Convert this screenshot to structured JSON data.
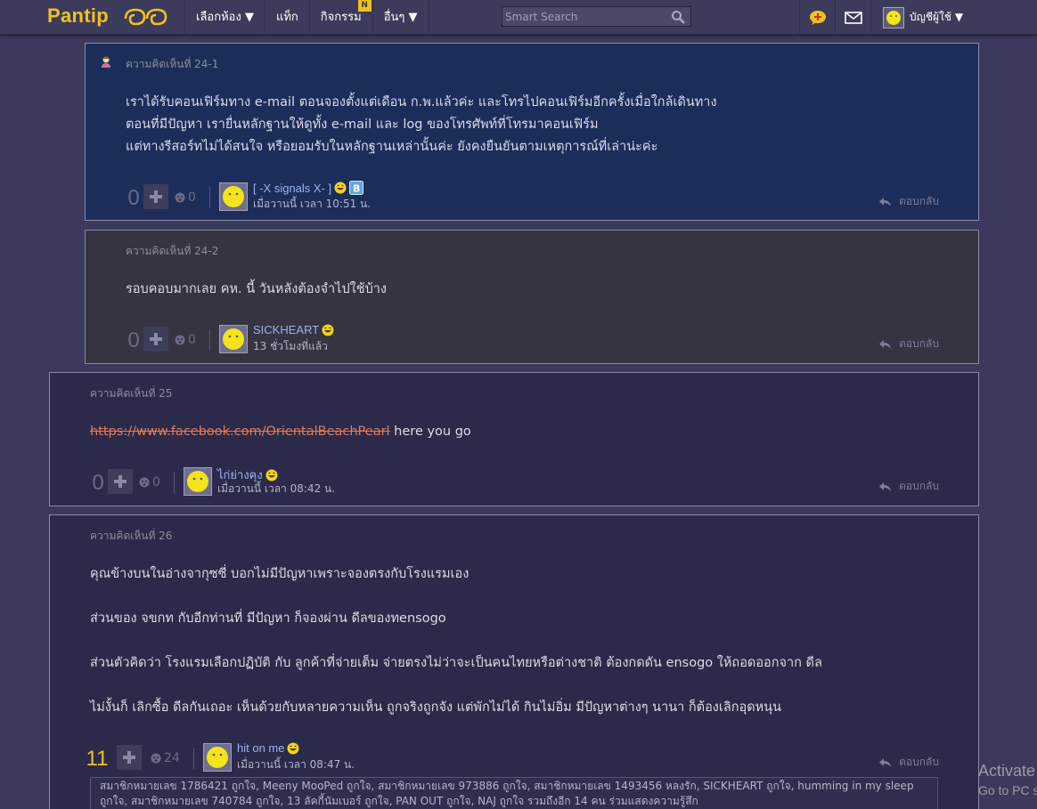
{
  "topbar": {
    "logo": "Pantip",
    "nav": [
      {
        "label": "เลือกห้อง ▼"
      },
      {
        "label": "แท็ก"
      },
      {
        "label": "กิจกรรม",
        "badge": "N"
      },
      {
        "label": "อื่นๆ ▼"
      }
    ],
    "search_placeholder": "Smart Search",
    "account_label": "บัญชีผู้ใช้ ▼"
  },
  "comments": [
    {
      "label": "ความคิดเห็นที่ 24-1",
      "body": "เราได้รับคอนเฟิร์มทาง e-mail ตอนจองตั้งแต่เดือน ก.พ.แล้วค่ะ และโทรไปคอนเฟิร์มอีกครั้งเมื่อใกล้เดินทาง\nตอนที่มีปัญหา เรายื่นหลักฐานให้ดูทั้ง e-mail และ log ของโทรศัพท์ที่โทรมาคอนเฟิร์ม\nแต่ทางรีสอร์ทไม่ได้สนใจ หรือยอมรับในหลักฐานเหล่านั้นค่ะ ยังคงยืนยันตามเหตุการณ์ที่เล่าน่ะค่ะ",
      "votes": "0",
      "emotions": "0",
      "user": "[ -X signals X- ]",
      "time": "เมื่อวานนี้ เวลา 10:51 น.",
      "reply": "ตอบกลับ"
    },
    {
      "label": "ความคิดเห็นที่ 24-2",
      "body": "รอบคอบมากเลย คห. นี้ วันหลังต้องจำไปใช้บ้าง",
      "votes": "0",
      "emotions": "0",
      "user": "SICKHEART",
      "time": "13 ชั่วโมงที่แล้ว",
      "reply": "ตอบกลับ"
    },
    {
      "label": "ความคิดเห็นที่ 25",
      "link": "https://www.facebook.com/OrientalBeachPearl",
      "body": " here you go",
      "votes": "0",
      "emotions": "0",
      "user": "ไก่ย่างคุง",
      "time": "เมื่อวานนี้ เวลา 08:42 น.",
      "reply": "ตอบกลับ"
    },
    {
      "label": "ความคิดเห็นที่ 26",
      "body": "คุณข้างบนในอ่างจากุซซี่ บอกไม่มีปัญหาเพราะจองตรงกับโรงแรมเอง\n\nส่วนของ จขกท กับอีกท่านที่ มีปัญหา ก็จองผ่าน ดีลของทensogo\n\nส่วนตัวคิดว่า  โรงแรมเลือกปฏิบัติ กับ ลูกค้าที่จ่ายเต็ม จ่ายตรงไม่ว่าจะเป็นคนไทยหรือต่างชาติ  ต้องกดดัน ensogo ให้ถอดออกจาก ดีล\n\nไม่งั้นก็ เลิกซื้อ ดีลกันเถอะ เห็นด้วยกับหลายความเห็น ถูกจริงถูกจัง แต่พักไม่ได้ กินไม่อิ่ม มีปัญหาต่างๆ นานา ก็ต้องเลิกอุดหนุน",
      "votes": "11",
      "emotions": "24",
      "user": "hit on me",
      "time": "เมื่อวานนี้ เวลา 08:47 น.",
      "reply": "ตอบกลับ",
      "likers": "สมาชิกหมายเลข 1786421 ถูกใจ, Meeny MooPed ถูกใจ, สมาชิกหมายเลข 973886 ถูกใจ, สมาชิกหมายเลข 1493456 หลงรัก, SICKHEART ถูกใจ, humming in my sleep ถูกใจ, สมาชิกหมายเลข 740784 ถูกใจ, 13 ลัคกี้นัมเบอร์ ถูกใจ, PAN OUT ถูกใจ, NAJ ถูกใจ รวมถึงอีก 14 คน ร่วมแสดงความรู้สึก"
    }
  ],
  "watermark": {
    "line1": "Activate",
    "line2": "Go to PC s"
  },
  "colors": {
    "accent": "#f2c01e",
    "link": "#9cb3f0",
    "background": "#3b3a5c"
  }
}
